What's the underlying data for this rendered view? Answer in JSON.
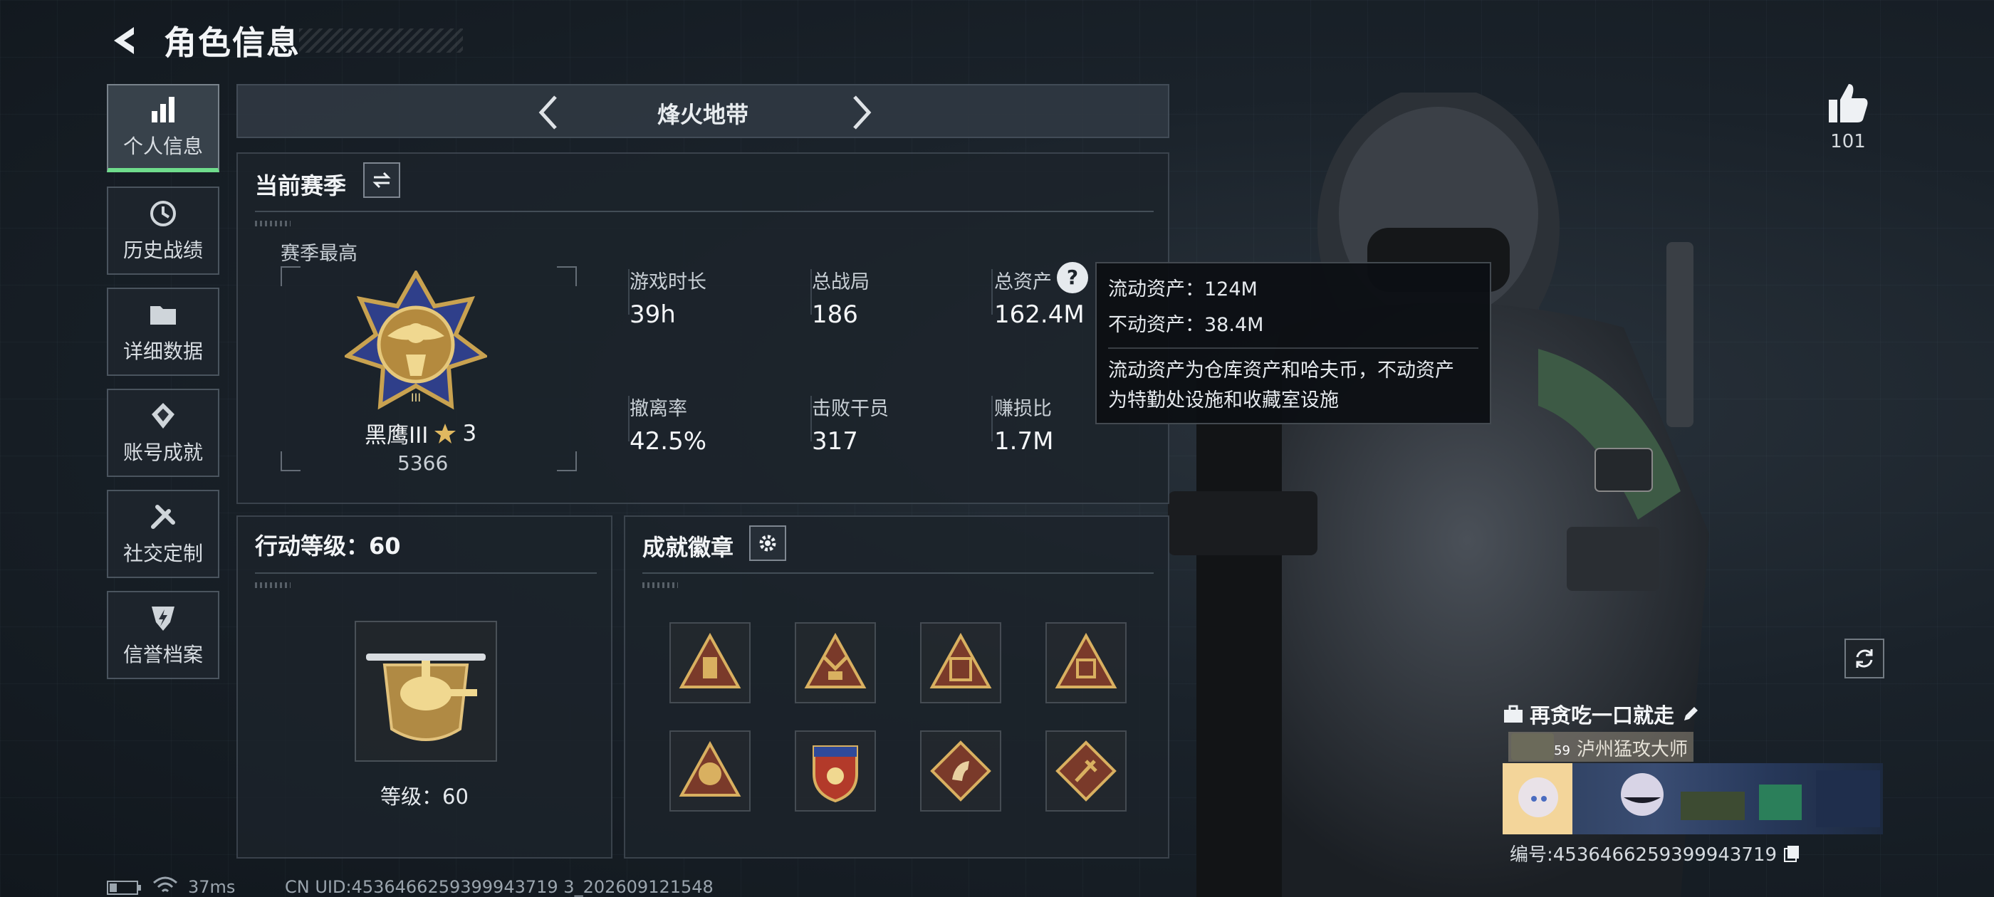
{
  "header": {
    "title": "角色信息"
  },
  "nav": {
    "items": [
      {
        "label": "个人信息",
        "icon": "bar-chart-icon",
        "active": true
      },
      {
        "label": "历史战绩",
        "icon": "history-icon"
      },
      {
        "label": "详细数据",
        "icon": "folder-icon"
      },
      {
        "label": "账号成就",
        "icon": "achievement-icon"
      },
      {
        "label": "社交定制",
        "icon": "tools-icon"
      },
      {
        "label": "信誉档案",
        "icon": "shield-icon"
      }
    ]
  },
  "mode": {
    "title": "烽火地带"
  },
  "season": {
    "title": "当前赛季",
    "best_label": "赛季最高",
    "rank_name": "黑鹰III",
    "rank_stars": "3",
    "rank_score": "5366",
    "stats": [
      {
        "label": "游戏时长",
        "value": "39h"
      },
      {
        "label": "总战局",
        "value": "186"
      },
      {
        "label": "总资产",
        "value": "162.4M"
      },
      {
        "label": "撤离率",
        "value": "42.5%"
      },
      {
        "label": "击败干员",
        "value": "317"
      },
      {
        "label": "赚损比",
        "value": "1.7M"
      }
    ]
  },
  "tooltip": {
    "liquid": "流动资产：124M",
    "fixed": "不动资产：38.4M",
    "desc_line1": "流动资产为仓库资产和哈夫币，不动资产",
    "desc_line2": "为特勤处设施和收藏室设施"
  },
  "action_level": {
    "title": "行动等级：60",
    "level_label": "等级：60"
  },
  "badges": {
    "title": "成就徽章",
    "items": [
      "badge-1",
      "badge-2",
      "badge-3",
      "badge-4",
      "badge-5",
      "badge-6",
      "badge-7",
      "badge-8"
    ]
  },
  "profile": {
    "likes": "101",
    "team_name": "再贪吃一口就走",
    "level": "59",
    "player_name": "泸州猛攻大师",
    "serial": "编号:4536466259399943719"
  },
  "status": {
    "ping": "37ms",
    "uid": "CN UID:4536466259399943719 3_202609121548"
  },
  "colors": {
    "accent_green": "#6fdc8c",
    "gold": "#c9a250"
  }
}
